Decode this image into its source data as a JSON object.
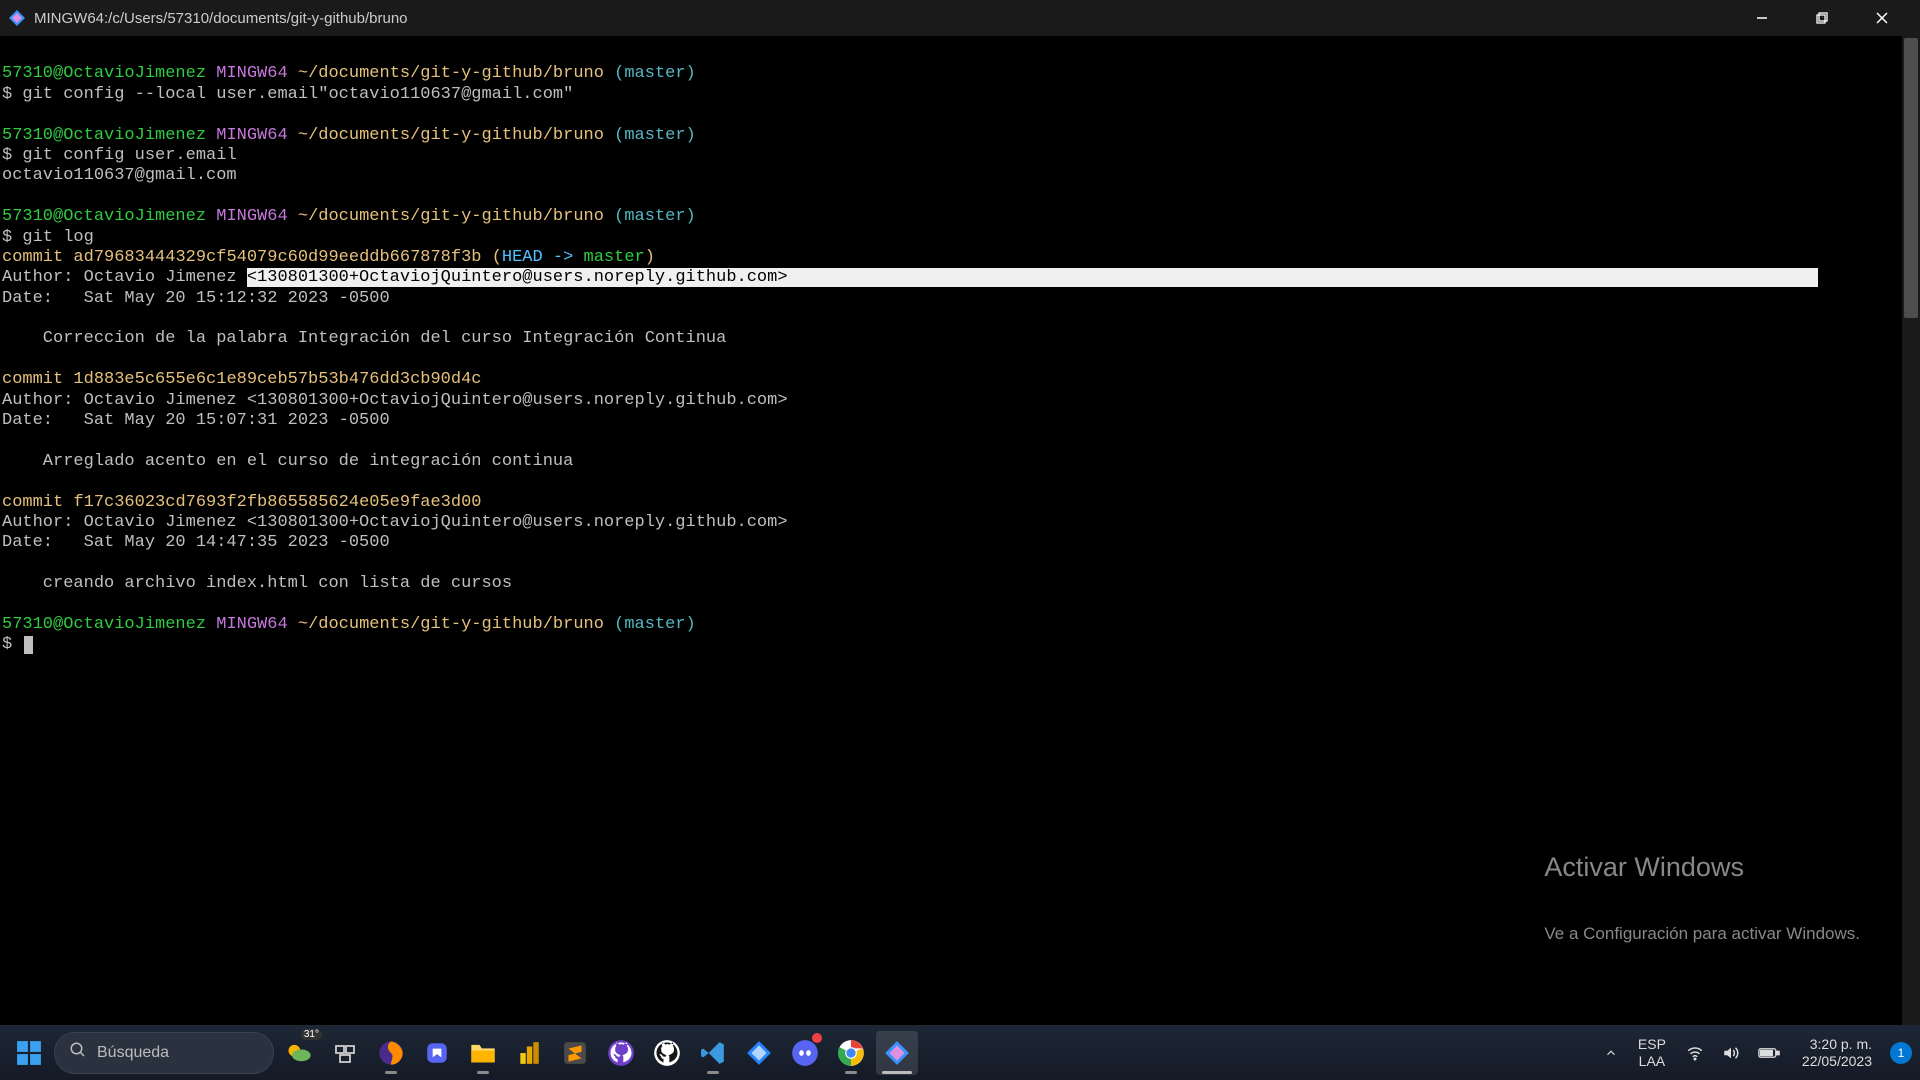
{
  "window": {
    "title": "MINGW64:/c/Users/57310/documents/git-y-github/bruno"
  },
  "prompts": [
    {
      "user": "57310@OctavioJimenez",
      "host": "MINGW64",
      "path": "~/documents/git-y-github/bruno",
      "branch": "(master)"
    }
  ],
  "terminal": {
    "cmd1": "git config --local user.email\"octavio110637@gmail.com\"",
    "cmd2": "git config user.email",
    "out2": "octavio110637@gmail.com",
    "cmd3": "git log",
    "commits": [
      {
        "hash_label": "commit ",
        "hash": "ad79683444329cf54079c60d99eeddb667878f3b",
        "ref_open": " (",
        "head": "HEAD -> ",
        "master": "master",
        "ref_close": ")",
        "author_label": "Author: Octavio Jimenez ",
        "author_email": "<130801300+OctaviojQuintero@users.noreply.github.com>",
        "date": "Date:   Sat May 20 15:12:32 2023 -0500",
        "msg": "    Correccion de la palabra Integración del curso Integración Continua",
        "highlighted": true
      },
      {
        "hash_label": "commit ",
        "hash": "1d883e5c655e6c1e89ceb57b53b476dd3cb90d4c",
        "author": "Author: Octavio Jimenez <130801300+OctaviojQuintero@users.noreply.github.com>",
        "date": "Date:   Sat May 20 15:07:31 2023 -0500",
        "msg": "    Arreglado acento en el curso de integración continua"
      },
      {
        "hash_label": "commit ",
        "hash": "f17c36023cd7693f2fb865585624e05e9fae3d00",
        "author": "Author: Octavio Jimenez <130801300+OctaviojQuintero@users.noreply.github.com>",
        "date": "Date:   Sat May 20 14:47:35 2023 -0500",
        "msg": "    creando archivo index.html con lista de cursos"
      }
    ],
    "dollar": "$ "
  },
  "watermark": {
    "title": "Activar Windows",
    "sub": "Ve a Configuración para activar Windows."
  },
  "taskbar": {
    "search_placeholder": "Búsqueda",
    "weather_temp": "31°",
    "lang1": "ESP",
    "lang2": "LAA",
    "time": "3:20 p. m.",
    "date": "22/05/2023",
    "notif": "1"
  }
}
